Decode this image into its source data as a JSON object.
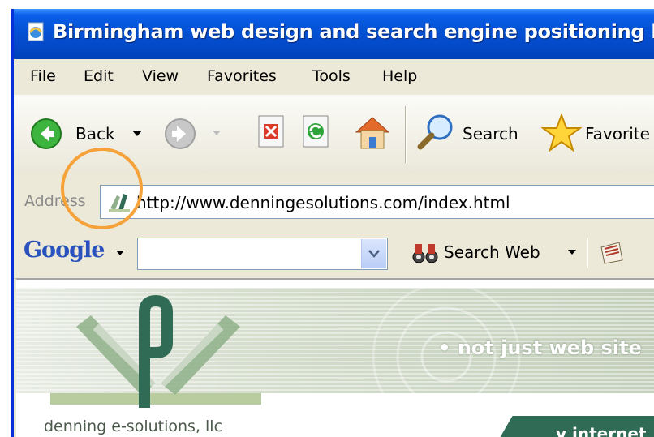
{
  "window": {
    "title": "Birmingham web design and search engine positioning by"
  },
  "menu": [
    "File",
    "Edit",
    "View",
    "Favorites",
    "Tools",
    "Help"
  ],
  "toolbar": {
    "back_label": "Back",
    "search_label": "Search",
    "favorites_label": "Favorite"
  },
  "address": {
    "label": "Address",
    "url": "http://www.denningesolutions.com/index.html"
  },
  "google": {
    "logo": "Google",
    "search_web_label": "Search Web",
    "query": ""
  },
  "page": {
    "tagline": "• not just web site",
    "company": "denning e-solutions, llc",
    "sub_tab": "v internet"
  },
  "colors": {
    "title_bar": "#0453d6",
    "highlight": "#f5a23a",
    "brand_green": "#2f6b55"
  }
}
